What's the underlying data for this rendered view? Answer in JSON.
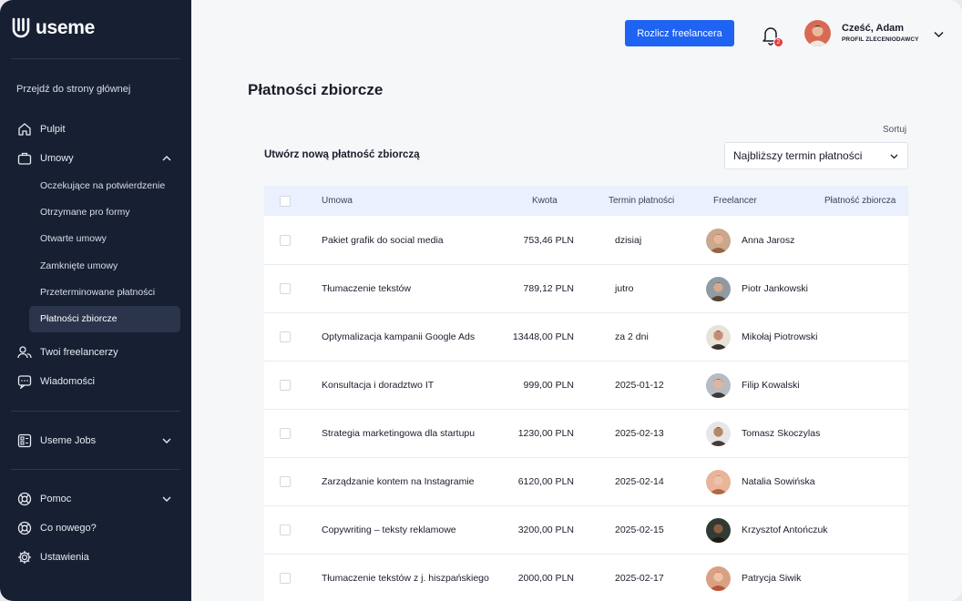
{
  "brand": {
    "name": "useme"
  },
  "sidebar": {
    "home_link": "Przejdź do strony głównej",
    "items": [
      {
        "label": "Pulpit"
      },
      {
        "label": "Umowy"
      },
      {
        "label": "Twoi freelancerzy"
      },
      {
        "label": "Wiadomości"
      },
      {
        "label": "Useme Jobs"
      },
      {
        "label": "Pomoc"
      },
      {
        "label": "Co nowego?"
      },
      {
        "label": "Ustawienia"
      }
    ],
    "contracts_sub": [
      {
        "label": "Oczekujące na potwierdzenie"
      },
      {
        "label": "Otrzymane pro formy"
      },
      {
        "label": "Otwarte umowy"
      },
      {
        "label": "Zamknięte umowy"
      },
      {
        "label": "Przeterminowane płatności"
      },
      {
        "label": "Płatności zbiorcze"
      }
    ]
  },
  "header": {
    "settle_button": "Rozlicz freelancera",
    "notifications_count": "2",
    "greeting": "Cześć, Adam",
    "role": "PROFIL ZLECENIODAWCY"
  },
  "page": {
    "title": "Płatności zbiorcze",
    "create_link": "Utwórz nową płatność zbiorczą",
    "sort_label": "Sortuj",
    "sort_value": "Najbliższy termin płatności"
  },
  "table": {
    "columns": [
      "Umowa",
      "Kwota",
      "Termin płatności",
      "Freelancer",
      "Płatność zbiorcza"
    ],
    "rows": [
      {
        "contract": "Pakiet grafik do social media",
        "amount": "753,46 PLN",
        "due": "dzisiaj",
        "freelancer": "Anna Jarosz"
      },
      {
        "contract": "Tłumaczenie tekstów",
        "amount": "789,12 PLN",
        "due": "jutro",
        "freelancer": "Piotr Jankowski"
      },
      {
        "contract": "Optymalizacja kampanii Google Ads",
        "amount": "13448,00 PLN",
        "due": "za 2 dni",
        "freelancer": "Mikołaj Piotrowski"
      },
      {
        "contract": "Konsultacja i doradztwo IT",
        "amount": "999,00 PLN",
        "due": "2025-01-12",
        "freelancer": "Filip Kowalski"
      },
      {
        "contract": "Strategia marketingowa dla startupu",
        "amount": "1230,00 PLN",
        "due": "2025-02-13",
        "freelancer": "Tomasz Skoczylas"
      },
      {
        "contract": "Zarządzanie kontem na Instagramie",
        "amount": "6120,00 PLN",
        "due": "2025-02-14",
        "freelancer": "Natalia Sowińska"
      },
      {
        "contract": "Copywriting – teksty reklamowe",
        "amount": "3200,00 PLN",
        "due": "2025-02-15",
        "freelancer": "Krzysztof Antończuk"
      },
      {
        "contract": "Tłumaczenie tekstów z j. hiszpańskiego",
        "amount": "2000,00 PLN",
        "due": "2025-02-17",
        "freelancer": "Patrycja Siwik"
      }
    ]
  }
}
